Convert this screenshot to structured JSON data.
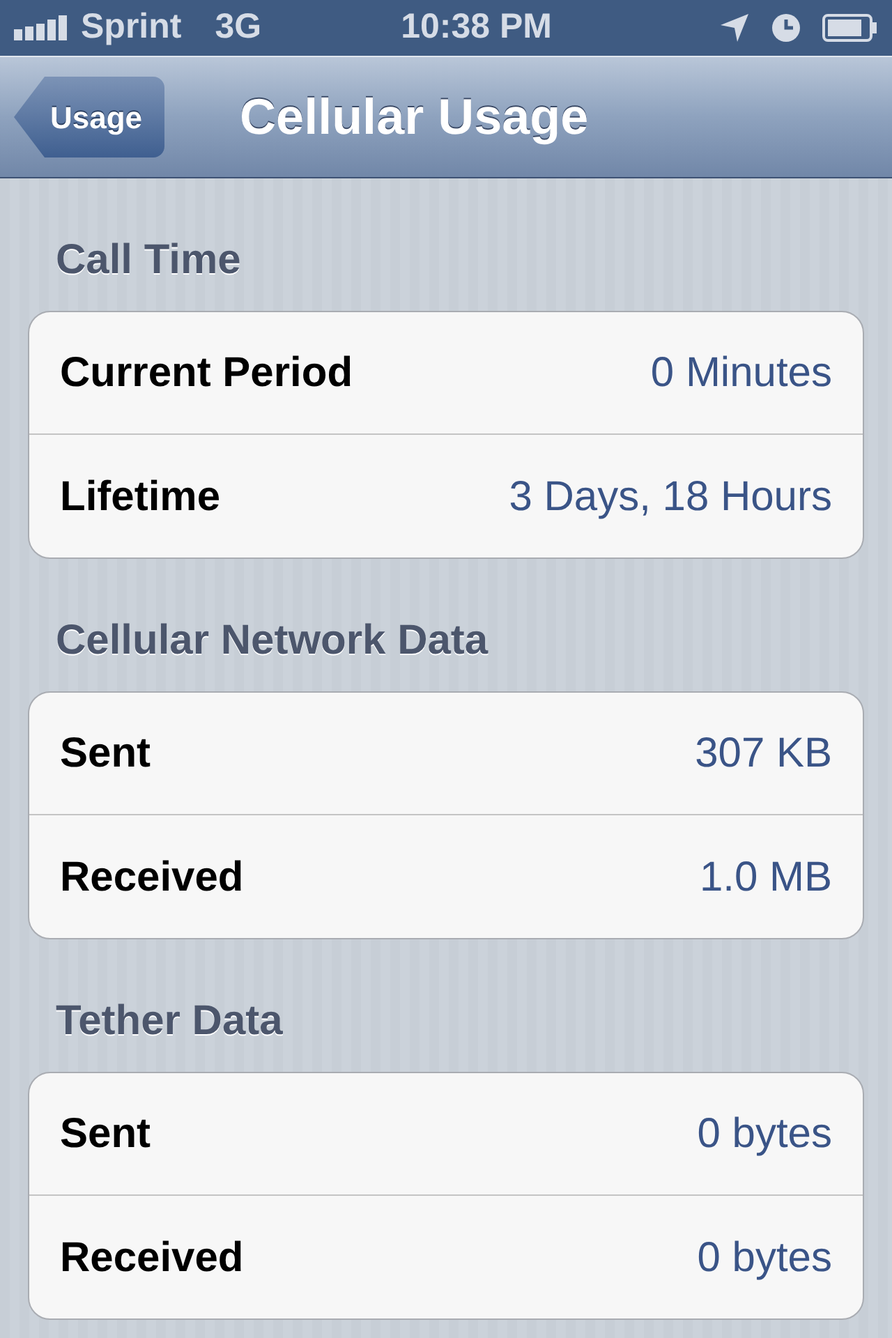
{
  "status_bar": {
    "carrier": "Sprint",
    "network": "3G",
    "time": "10:38 PM"
  },
  "nav_bar": {
    "back_button": "Usage",
    "title": "Cellular Usage"
  },
  "sections": [
    {
      "header": "Call Time",
      "rows": [
        {
          "label": "Current Period",
          "value": "0 Minutes"
        },
        {
          "label": "Lifetime",
          "value": "3 Days, 18 Hours"
        }
      ]
    },
    {
      "header": "Cellular Network Data",
      "rows": [
        {
          "label": "Sent",
          "value": "307 KB"
        },
        {
          "label": "Received",
          "value": "1.0 MB"
        }
      ]
    },
    {
      "header": "Tether Data",
      "rows": [
        {
          "label": "Sent",
          "value": "0 bytes"
        },
        {
          "label": "Received",
          "value": "0 bytes"
        }
      ]
    }
  ]
}
